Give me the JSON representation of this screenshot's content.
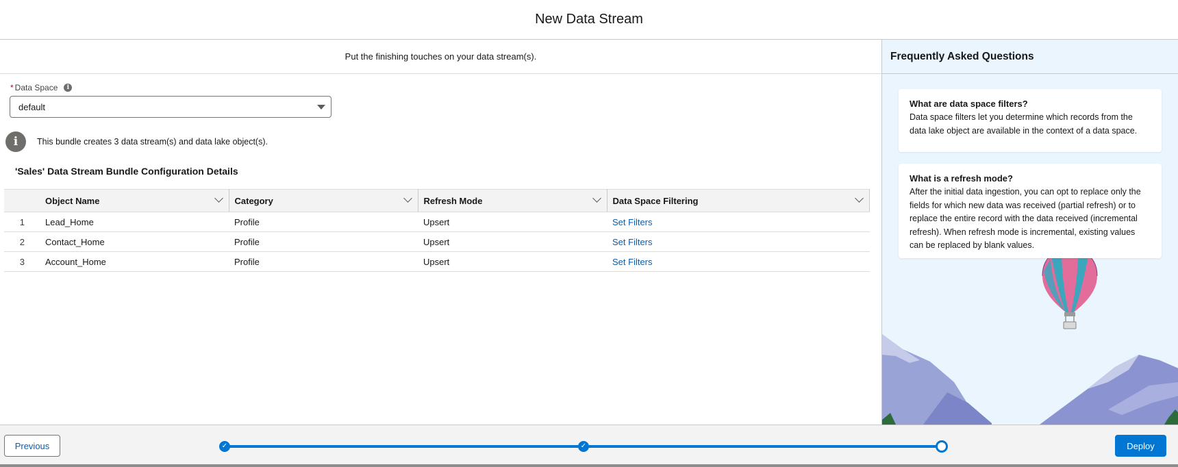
{
  "header": {
    "title": "New Data Stream"
  },
  "main": {
    "subtitle": "Put the finishing touches on your data stream(s).",
    "data_space": {
      "label": "Data Space",
      "required_mark": "*",
      "value": "default"
    },
    "notice": "This bundle creates 3 data stream(s) and data lake object(s).",
    "bundle_title": "'Sales' Data Stream Bundle Configuration Details",
    "table": {
      "columns": [
        "Object Name",
        "Category",
        "Refresh Mode",
        "Data Space Filtering"
      ],
      "rows": [
        {
          "num": "1",
          "object": "Lead_Home",
          "category": "Profile",
          "refresh": "Upsert",
          "filter": "Set Filters"
        },
        {
          "num": "2",
          "object": "Contact_Home",
          "category": "Profile",
          "refresh": "Upsert",
          "filter": "Set Filters"
        },
        {
          "num": "3",
          "object": "Account_Home",
          "category": "Profile",
          "refresh": "Upsert",
          "filter": "Set Filters"
        }
      ]
    }
  },
  "faq": {
    "title": "Frequently Asked Questions",
    "items": [
      {
        "q": "What are data space filters?",
        "a": "Data space filters let you determine which records from the data lake object are available in the context of a data space."
      },
      {
        "q": "What is a refresh mode?",
        "a": "After the initial data ingestion, you can opt to replace only the fields for which new data was received (partial refresh) or to replace the entire record with the data received (incremental refresh). When refresh mode is incremental, existing values can be replaced by blank values."
      }
    ]
  },
  "footer": {
    "previous_label": "Previous",
    "deploy_label": "Deploy",
    "steps": [
      "complete",
      "complete",
      "current"
    ]
  },
  "colors": {
    "brand": "#0176d3",
    "link": "#0b5cab",
    "faq_bg": "#eaf5fe"
  }
}
